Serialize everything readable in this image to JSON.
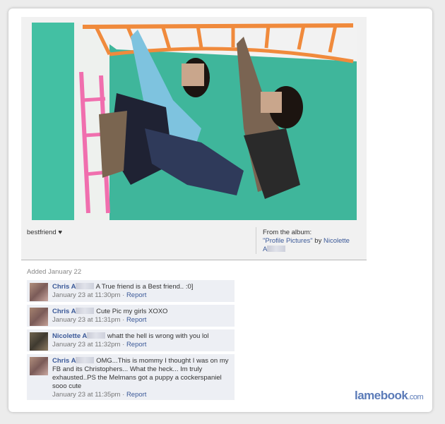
{
  "photo": {
    "caption": "bestfriend ♥",
    "album_prefix": "From the album:",
    "album_name": "\"Profile Pictures\"",
    "album_by": "by",
    "album_owner": "Nicolette",
    "album_owner_last": "A"
  },
  "added": "Added January 22",
  "comments": [
    {
      "author": "Chris A",
      "text": "A True friend is a Best friend.. :0]",
      "date": "January 23 at 11:30pm",
      "action": "Report"
    },
    {
      "author": "Chris A",
      "text": "Cute Pic my girls XOXO",
      "date": "January 23 at 11:31pm",
      "action": "Report"
    },
    {
      "author": "Nicolette A",
      "text": "whatt the hell is wrong with you lol",
      "date": "January 23 at 11:32pm",
      "action": "Report"
    },
    {
      "author": "Chris A",
      "text": "OMG...This is mommy I thought I was on my FB and its Christophers... What the heck... Im truly exhausted..PS the Melmans got a puppy a cockerspaniel sooo cute",
      "date": "January 23 at 11:35pm",
      "action": "Report"
    }
  ],
  "brand": {
    "name": "lamebook",
    "suffix": ".com"
  },
  "colors": {
    "link": "#3b5998",
    "comment_bg": "#edeff4",
    "wall": "#40b79b"
  }
}
